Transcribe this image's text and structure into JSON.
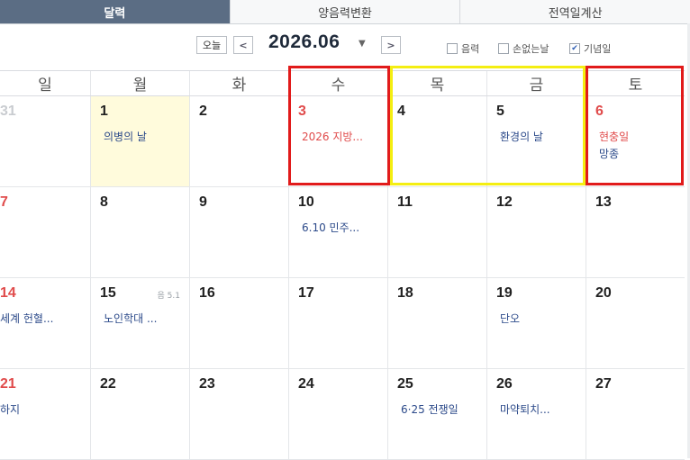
{
  "tabs": [
    {
      "label": "달력",
      "active": true
    },
    {
      "label": "양음력변환",
      "active": false
    },
    {
      "label": "전역일계산",
      "active": false
    }
  ],
  "controls": {
    "today_label": "오늘",
    "prev_icon": "<",
    "next_icon": ">",
    "month": "2026.06",
    "options": [
      {
        "label": "음력",
        "checked": false
      },
      {
        "label": "손없는날",
        "checked": false
      },
      {
        "label": "기념일",
        "checked": true
      }
    ]
  },
  "weekdays": [
    "일",
    "월",
    "화",
    "수",
    "목",
    "금",
    "토"
  ],
  "weeks": [
    [
      {
        "day": "31",
        "other": true
      },
      {
        "day": "1",
        "today": true,
        "events": [
          "의병의 날"
        ]
      },
      {
        "day": "2"
      },
      {
        "day": "3",
        "red": true,
        "events": [
          "2026 지방..."
        ],
        "events_red": true
      },
      {
        "day": "4"
      },
      {
        "day": "5",
        "events": [
          "환경의 날"
        ]
      },
      {
        "day": "6",
        "red": true,
        "events": [
          "현충일",
          "망종"
        ],
        "first_red": true
      }
    ],
    [
      {
        "day": "7",
        "red": true
      },
      {
        "day": "8"
      },
      {
        "day": "9"
      },
      {
        "day": "10",
        "events": [
          "6.10 민주..."
        ]
      },
      {
        "day": "11"
      },
      {
        "day": "12"
      },
      {
        "day": "13"
      }
    ],
    [
      {
        "day": "14",
        "red": true,
        "events": [
          "세계 헌혈..."
        ]
      },
      {
        "day": "15",
        "lunar": "음 5.1",
        "events": [
          "노인학대 ..."
        ]
      },
      {
        "day": "16"
      },
      {
        "day": "17"
      },
      {
        "day": "18"
      },
      {
        "day": "19",
        "events": [
          "단오"
        ]
      },
      {
        "day": "20"
      }
    ],
    [
      {
        "day": "21",
        "red": true,
        "events": [
          "하지"
        ]
      },
      {
        "day": "22"
      },
      {
        "day": "23"
      },
      {
        "day": "24"
      },
      {
        "day": "25",
        "events": [
          "6·25 전쟁일"
        ]
      },
      {
        "day": "26",
        "events": [
          "마약퇴치..."
        ]
      },
      {
        "day": "27"
      }
    ]
  ],
  "colors": {
    "holiday": "#e04b4b",
    "event": "#2c4a8a",
    "today_bg": "#fffbdc",
    "tab_active": "#5b6d84"
  }
}
